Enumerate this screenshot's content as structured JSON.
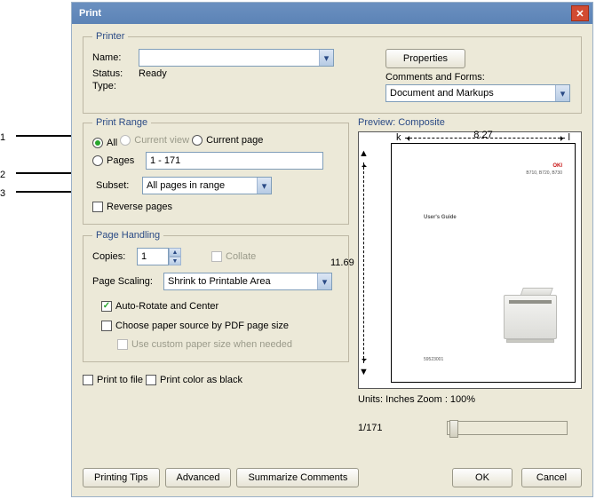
{
  "annotations": {
    "a1": "1",
    "a2": "2",
    "a3": "3"
  },
  "window": {
    "title": "Print"
  },
  "printer_group": {
    "legend": "Printer",
    "name_label": "Name:",
    "name_value": "",
    "status_label": "Status:",
    "status_value": "Ready",
    "type_label": "Type:",
    "type_value": "",
    "properties_button": "Properties",
    "comments_label": "Comments and Forms:",
    "comments_value": "Document and Markups"
  },
  "range_group": {
    "legend": "Print Range",
    "opt_all": "All",
    "opt_current_view": "Current view",
    "opt_current_page": "Current page",
    "opt_pages": "Pages",
    "pages_value": "1 - 171",
    "subset_label": "Subset:",
    "subset_value": "All pages in range",
    "reverse_label": "Reverse pages"
  },
  "handling_group": {
    "legend": "Page Handling",
    "copies_label": "Copies:",
    "copies_value": "1",
    "collate_label": "Collate",
    "scaling_label": "Page Scaling:",
    "scaling_value": "Shrink to Printable Area",
    "auto_rotate_label": "Auto-Rotate and Center",
    "choose_source_label": "Choose paper source by PDF page size",
    "custom_size_label": "Use custom paper size when needed"
  },
  "misc": {
    "print_to_file": "Print to file",
    "print_color_black": "Print color as black"
  },
  "preview": {
    "legend": "Preview: Composite",
    "width_label": "8.27",
    "height_label": "11.69",
    "doc_brand": "OKI",
    "doc_subtitle": "B710, B720, B730",
    "doc_heading": "User's Guide",
    "doc_partno": "59523001",
    "units_label": "Units: Inches Zoom : 100%",
    "page_counter": "1/171"
  },
  "bottom": {
    "printing_tips": "Printing Tips",
    "advanced": "Advanced",
    "summarize": "Summarize Comments",
    "ok": "OK",
    "cancel": "Cancel"
  }
}
